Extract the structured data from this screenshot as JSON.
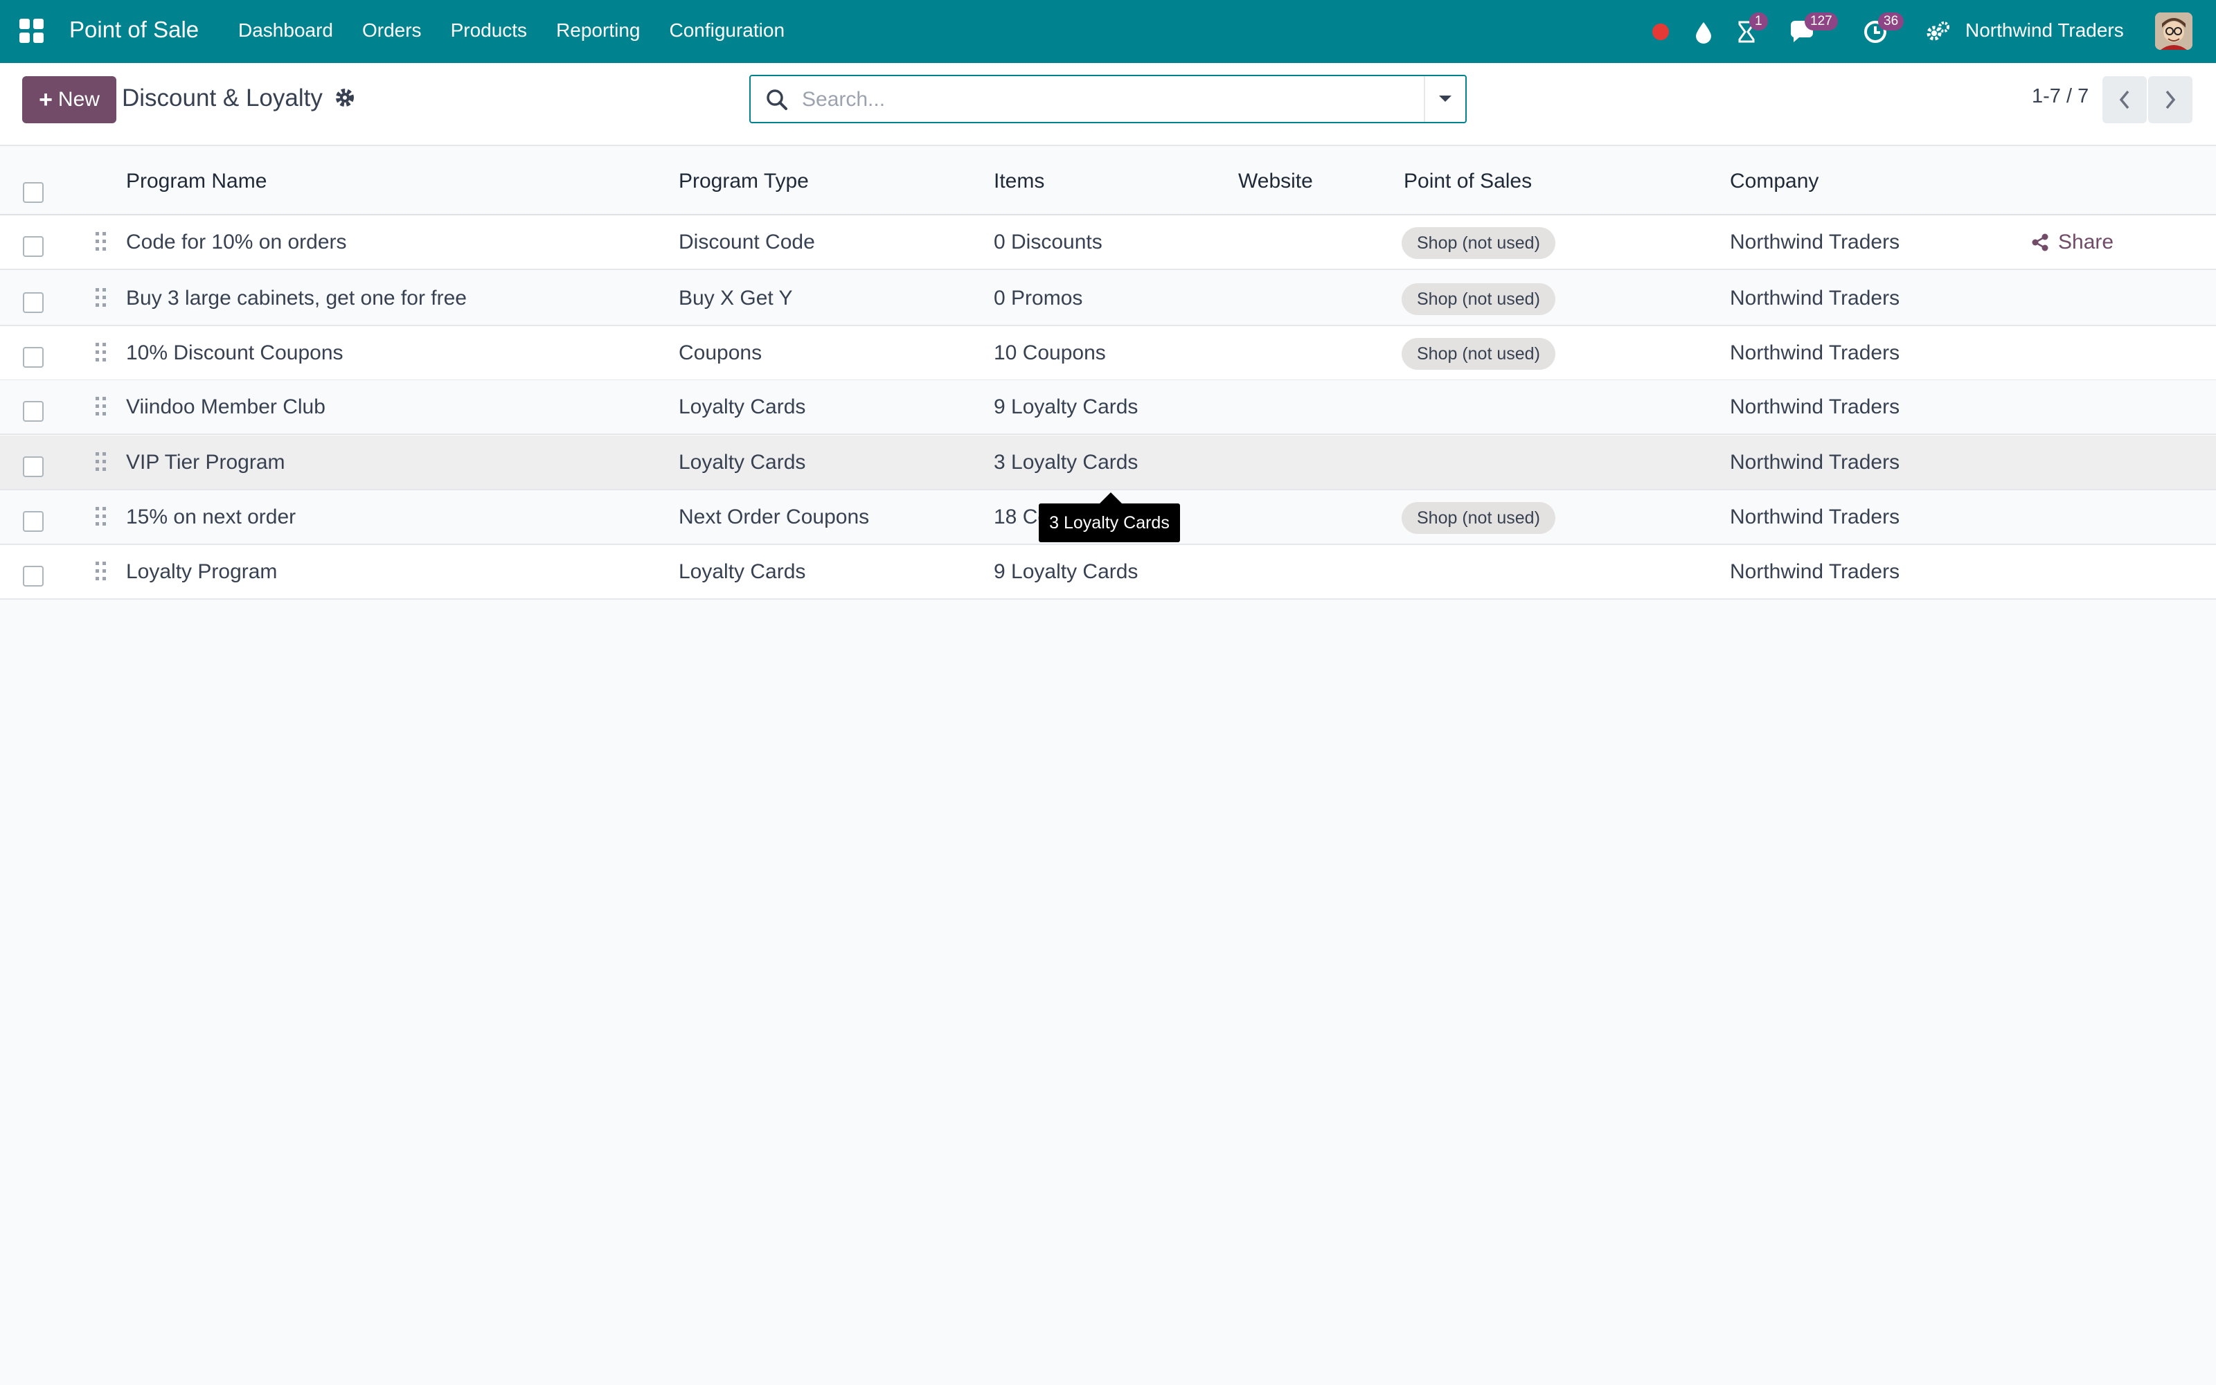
{
  "navbar": {
    "app_name": "Point of Sale",
    "menu": [
      "Dashboard",
      "Orders",
      "Products",
      "Reporting",
      "Configuration"
    ],
    "activity_badge": "1",
    "messages_badge": "127",
    "clock_badge": "36",
    "company": "Northwind Traders"
  },
  "control_panel": {
    "new_label": "New",
    "breadcrumb": "Discount & Loyalty",
    "search_placeholder": "Search...",
    "pager_value": "1-7 / 7"
  },
  "table": {
    "headers": {
      "program_name": "Program Name",
      "program_type": "Program Type",
      "items": "Items",
      "website": "Website",
      "point_of_sales": "Point of Sales",
      "company": "Company"
    },
    "rows": [
      {
        "name": "Code for 10% on orders",
        "type": "Discount Code",
        "items": "0 Discounts",
        "website": "",
        "pos": "Shop (not used)",
        "company": "Northwind Traders"
      },
      {
        "name": "Buy 3 large cabinets, get one for free",
        "type": "Buy X Get Y",
        "items": "0 Promos",
        "website": "",
        "pos": "Shop (not used)",
        "company": "Northwind Traders"
      },
      {
        "name": "10% Discount Coupons",
        "type": "Coupons",
        "items": "10 Coupons",
        "website": "",
        "pos": "Shop (not used)",
        "company": "Northwind Traders"
      },
      {
        "name": "Viindoo Member Club",
        "type": "Loyalty Cards",
        "items": "9 Loyalty Cards",
        "website": "",
        "pos": "",
        "company": "Northwind Traders"
      },
      {
        "name": "VIP Tier Program",
        "type": "Loyalty Cards",
        "items": "3 Loyalty Cards",
        "website": "",
        "pos": "",
        "company": "Northwind Traders"
      },
      {
        "name": "15% on next order",
        "type": "Next Order Coupons",
        "items": "18 Coupons",
        "website": "",
        "pos": "Shop (not used)",
        "company": "Northwind Traders"
      },
      {
        "name": "Loyalty Program",
        "type": "Loyalty Cards",
        "items": "9 Loyalty Cards",
        "website": "",
        "pos": "",
        "company": "Northwind Traders"
      }
    ],
    "share_label": "Share"
  },
  "tooltip": {
    "text": "3 Loyalty Cards"
  },
  "colors": {
    "navbar": "#00838f",
    "primary_button": "#714b67",
    "badge": "#8e4585",
    "status_dot": "#e53935"
  }
}
